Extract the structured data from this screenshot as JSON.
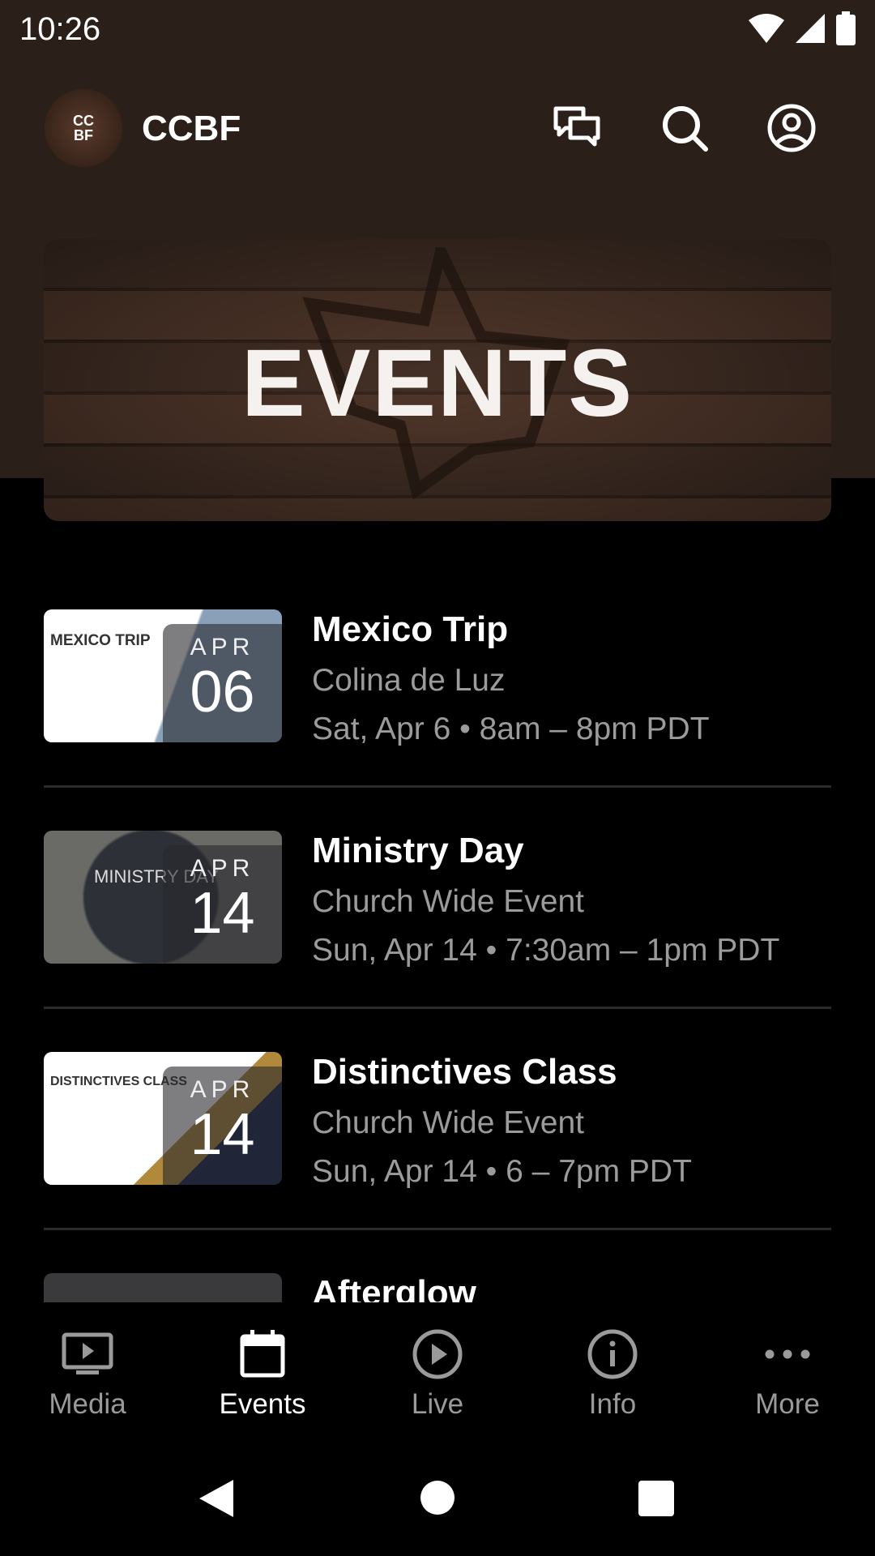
{
  "status_bar": {
    "time": "10:26",
    "icons": [
      "wifi-icon",
      "cellular-icon",
      "battery-icon"
    ]
  },
  "header": {
    "avatar_text": [
      "CC",
      "BF"
    ],
    "title": "CCBF",
    "icons": [
      "chat-icon",
      "search-icon",
      "account-icon"
    ]
  },
  "banner": {
    "title": "EVENTS"
  },
  "events": [
    {
      "title": "Mexico Trip",
      "subtitle": "Colina de Luz",
      "meta": "Sat, Apr 6 • 8am – 8pm PDT",
      "month": "APR",
      "day": "06",
      "thumb_text": "MEXICO TRIP",
      "thumb_bg": "#ffffff"
    },
    {
      "title": "Ministry Day",
      "subtitle": "Church Wide Event",
      "meta": "Sun, Apr 14 • 7:30am – 1pm PDT",
      "month": "APR",
      "day": "14",
      "thumb_text": "MINISTRY DAY",
      "thumb_bg": "#3a3c44"
    },
    {
      "title": "Distinctives Class",
      "subtitle": "Church Wide Event",
      "meta": "Sun, Apr 14 • 6 – 7pm PDT",
      "month": "APR",
      "day": "14",
      "thumb_text": "DISTINCTIVES CLASS",
      "thumb_bg": "#ffffff"
    },
    {
      "title": "Afterglow",
      "subtitle": "",
      "meta": "",
      "month": "",
      "day": "",
      "thumb_text": "",
      "thumb_bg": "#333333"
    }
  ],
  "bottom_nav": [
    {
      "label": "Media",
      "icon": "tv-play-icon"
    },
    {
      "label": "Events",
      "icon": "calendar-icon",
      "active": true
    },
    {
      "label": "Live",
      "icon": "play-circle-icon"
    },
    {
      "label": "Info",
      "icon": "info-icon"
    },
    {
      "label": "More",
      "icon": "more-horizontal-icon"
    }
  ],
  "colors": {
    "header_bg": "#2b1f19",
    "muted_text": "#9b9b9b",
    "background": "#000000"
  }
}
